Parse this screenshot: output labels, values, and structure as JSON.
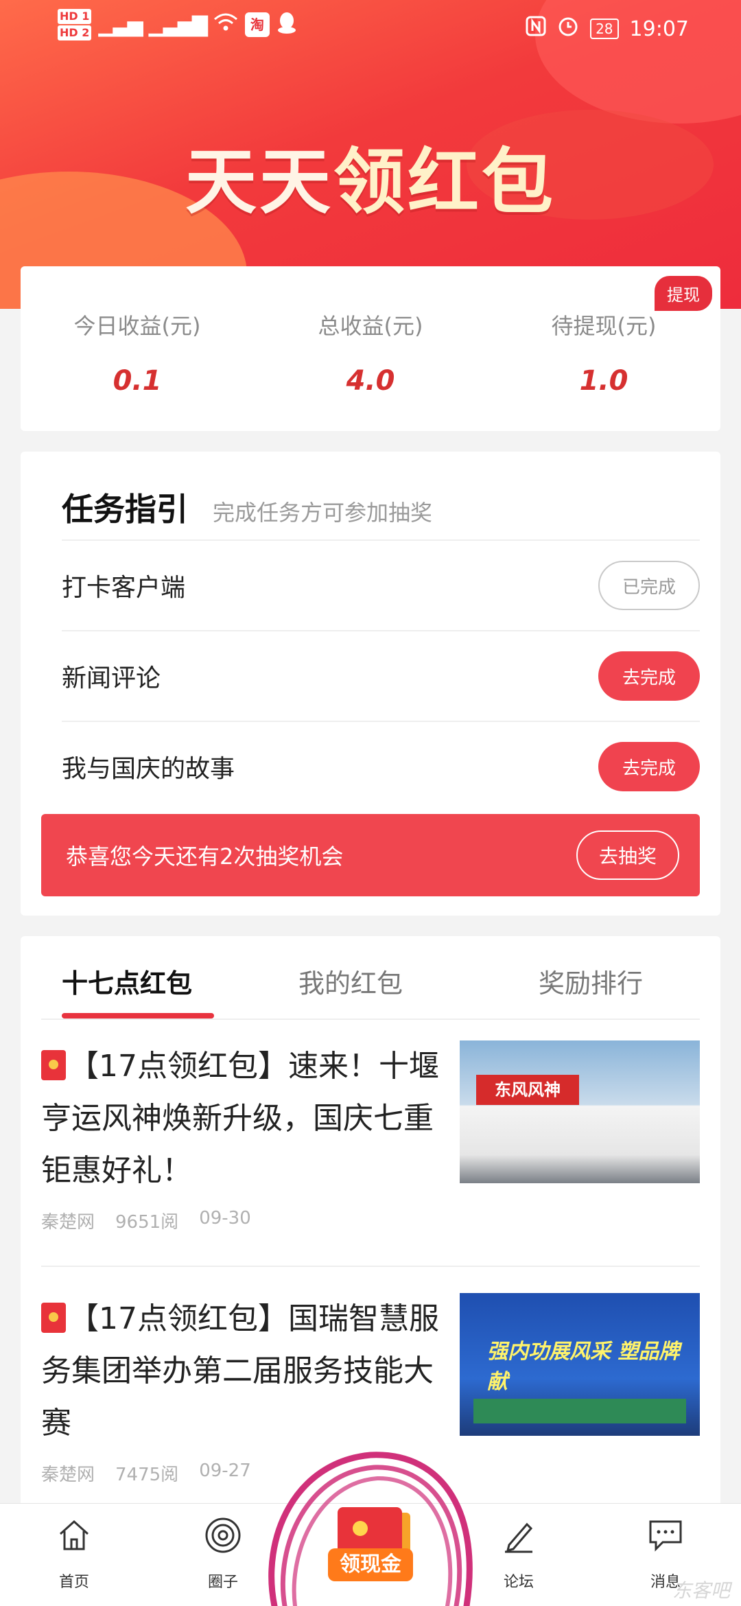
{
  "status_bar": {
    "hd1": "HD 1",
    "hd2": "HD 2",
    "signal": "4G",
    "battery": "28",
    "time": "19:07"
  },
  "header": {
    "title_part1": "天天",
    "title_part2": "领红包"
  },
  "earnings": {
    "withdraw_badge": "提现",
    "today_label": "今日收益(元)",
    "today_value": "0.1",
    "total_label": "总收益(元)",
    "total_value": "4.0",
    "pending_label": "待提现(元)",
    "pending_value": "1.0"
  },
  "tasks": {
    "title": "任务指引",
    "subtitle": "完成任务方可参加抽奖",
    "items": [
      {
        "name": "打卡客户端",
        "action": "已完成"
      },
      {
        "name": "新闻评论",
        "action": "去完成"
      },
      {
        "name": "我与国庆的故事",
        "action": "去完成"
      }
    ],
    "lottery_message": "恭喜您今天还有2次抽奖机会",
    "lottery_button": "去抽奖"
  },
  "news": {
    "tabs": [
      "十七点红包",
      "我的红包",
      "奖励排行"
    ],
    "articles": [
      {
        "title": "【17点领红包】速来！十堰亨运风神焕新升级，国庆七重钜惠好礼！",
        "source": "秦楚网",
        "reads": "9651阅",
        "date": "09-30",
        "thumb_text": "东风风神"
      },
      {
        "title": "【17点领红包】国瑞智慧服务集团举办第二届服务技能大赛",
        "source": "秦楚网",
        "reads": "7475阅",
        "date": "09-27",
        "thumb_text": "强内功展风采 塑品牌献"
      }
    ]
  },
  "nav": {
    "home": "首页",
    "circle": "圈子",
    "cash": "领现金",
    "forum": "论坛",
    "message": "消息"
  },
  "watermark": "东客吧",
  "colors": {
    "primary_red": "#e8333f",
    "header_gradient": [
      "#ff6b4a",
      "#ee2c3c"
    ],
    "value_red": "#d63030"
  }
}
